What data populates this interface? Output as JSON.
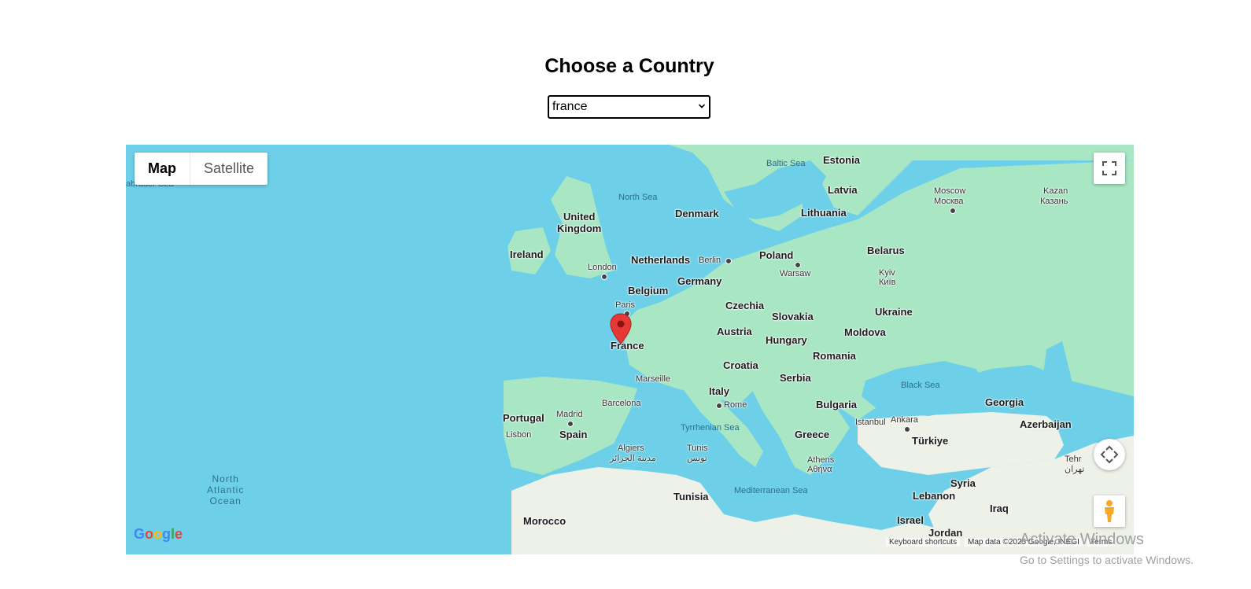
{
  "page": {
    "title": "Choose a Country"
  },
  "country_select": {
    "value": "france"
  },
  "map": {
    "type_control": {
      "map_label": "Map",
      "satellite_label": "Satellite"
    },
    "labels": {
      "countries": [
        "Estonia",
        "Latvia",
        "Lithuania",
        "Denmark",
        "United",
        "Kingdom",
        "Ireland",
        "Netherlands",
        "Poland",
        "Belarus",
        "Germany",
        "Belgium",
        "Czechia",
        "Slovakia",
        "Ukraine",
        "Austria",
        "France",
        "Hungary",
        "Moldova",
        "Romania",
        "Croatia",
        "Serbia",
        "Italy",
        "Bulgaria",
        "Georgia",
        "Portugal",
        "Spain",
        "Greece",
        "Türkiye",
        "Azerbaijan",
        "Tunisia",
        "Syria",
        "Lebanon",
        "Iraq",
        "Morocco",
        "Israel",
        "Jordan"
      ],
      "cities": [
        "London",
        "Berlin",
        "Warsaw",
        "Moscow",
        "Москва",
        "Kazan",
        "Казань",
        "Kyiv",
        "Київ",
        "Paris",
        "Marseille",
        "Barcelona",
        "Madrid",
        "Lisbon",
        "Rome",
        "Istanbul",
        "Ankara",
        "Athens",
        "Αθήνα",
        "Algiers",
        "مدينة الجزائر",
        "Tunis",
        "تونس",
        "Tehr",
        "تهران"
      ],
      "seas": [
        "Baltic Sea",
        "North Sea",
        "Black Sea",
        "Tyrrhenian Sea",
        "Mediterranean Sea",
        "abrador Sea"
      ],
      "ocean": [
        "North",
        "Atlantic",
        "Ocean"
      ]
    },
    "marker": {
      "color": "#e53935"
    },
    "attribution": {
      "logo": "Google",
      "shortcuts": "Keyboard shortcuts",
      "data": "Map data ©2025 Google, INEGI",
      "terms": "Terms"
    }
  },
  "watermark": {
    "line1": "Activate Windows",
    "line2": "Go to Settings to activate Windows."
  },
  "colors": {
    "water": "#6dd0e8",
    "land": "#a8e6c4",
    "land_south": "#eef1e8"
  }
}
